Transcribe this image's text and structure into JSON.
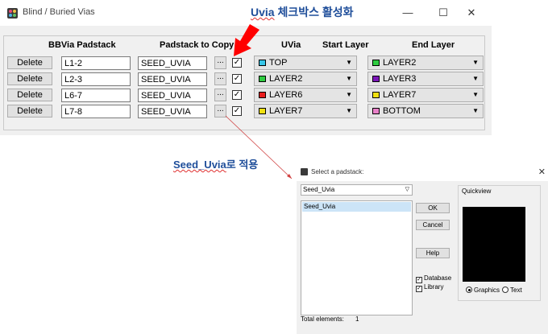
{
  "window": {
    "title": "Blind / Buried Vias",
    "min": "—",
    "max": "☐",
    "close": "✕"
  },
  "annotations": {
    "top_uvia": "Uvia",
    "top_rest": " 체크박스 활성화",
    "bottom_seed": "Seed_Uvia",
    "bottom_rest": "로 적용"
  },
  "headers": {
    "bbvia": "BBVia Padstack",
    "copy": "Padstack to Copy",
    "uvia": "UVia",
    "start": "Start Layer",
    "end": "End Layer"
  },
  "rows": [
    {
      "delete": "Delete",
      "bbvia": "L1-2",
      "copy": "SEED_UVIA",
      "dots": "...",
      "checked": "☑",
      "check_mark": "✓",
      "start": "TOP",
      "start_color": "#38c6e8",
      "end": "LAYER2",
      "end_color": "#2ecc40"
    },
    {
      "delete": "Delete",
      "bbvia": "L2-3",
      "copy": "SEED_UVIA",
      "dots": "...",
      "checked": "☑",
      "check_mark": "✓",
      "start": "LAYER2",
      "start_color": "#2ecc40",
      "end": "LAYER3",
      "end_color": "#7b16b8"
    },
    {
      "delete": "Delete",
      "bbvia": "L6-7",
      "copy": "SEED_UVIA",
      "dots": "...",
      "checked": "☑",
      "check_mark": "✓",
      "start": "LAYER6",
      "start_color": "#e81c1c",
      "end": "LAYER7",
      "end_color": "#f0e010"
    },
    {
      "delete": "Delete",
      "bbvia": "L7-8",
      "copy": "SEED_UVIA",
      "dots": "...",
      "checked": "☑",
      "check_mark": "✓",
      "start": "LAYER7",
      "start_color": "#f0e010",
      "end": "BOTTOM",
      "end_color": "#e880c8"
    }
  ],
  "dialog": {
    "title": "Select a padstack:",
    "close": "✕",
    "filter_value": "Seed_Uvia",
    "list_items": [
      "Seed_Uvia"
    ],
    "ok": "OK",
    "cancel": "Cancel",
    "help": "Help",
    "database": "Database",
    "library": "Library",
    "quickview": "Quickview",
    "graphics": "Graphics",
    "text": "Text",
    "total_label": "Total elements:",
    "total_value": "1"
  },
  "colors": {
    "annotation": "#1f4e9a",
    "arrow_red": "#ff0000",
    "connector": "#d04040"
  }
}
